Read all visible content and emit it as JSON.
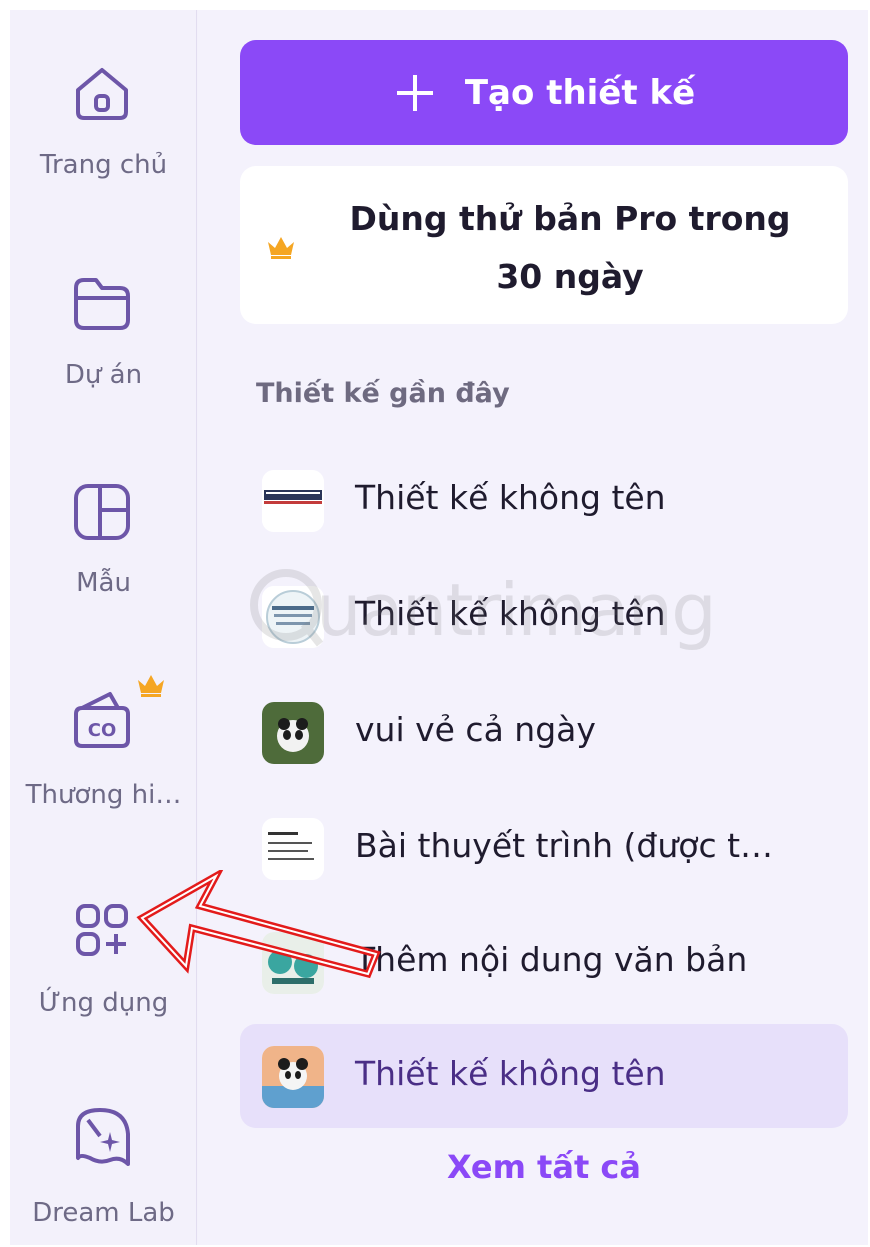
{
  "sidebar": {
    "items": [
      {
        "label": "Trang chủ",
        "icon": "home-icon"
      },
      {
        "label": "Dự án",
        "icon": "folder-icon"
      },
      {
        "label": "Mẫu",
        "icon": "template-icon"
      },
      {
        "label": "Thương hi…",
        "icon": "brand-kit-icon",
        "badge": "crown-icon"
      },
      {
        "label": "Ứng dụng",
        "icon": "apps-icon"
      },
      {
        "label": "Dream Lab",
        "icon": "dream-lab-icon"
      }
    ]
  },
  "create": {
    "label": "Tạo thiết kế"
  },
  "pro": {
    "line1": "Dùng thử bản Pro trong",
    "line2": "30 ngày"
  },
  "recent": {
    "title": "Thiết kế gần đây",
    "items": [
      {
        "name": "Thiết kế không tên"
      },
      {
        "name": "Thiết kế không tên"
      },
      {
        "name": "vui vẻ cả ngày"
      },
      {
        "name": "Bài thuyết trình (được t…"
      },
      {
        "name": "Thêm nội dung văn bản"
      },
      {
        "name": "Thiết kế không tên"
      }
    ],
    "see_all": "Xem tất cả"
  },
  "watermark": "uantrimang",
  "colors": {
    "accent": "#8b49f7",
    "rail_text": "#6e6a86",
    "crown": "#f5a623",
    "arrow": "#e31b1b"
  }
}
